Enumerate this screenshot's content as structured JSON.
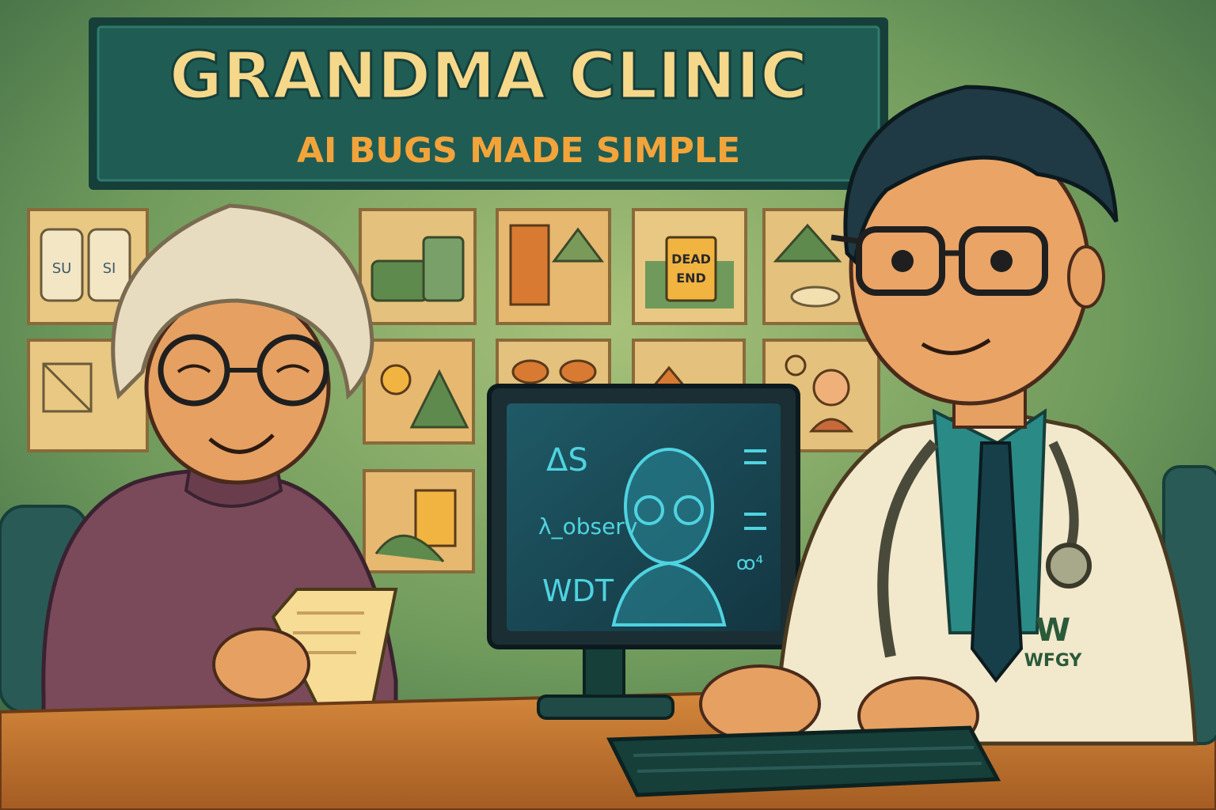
{
  "sign": {
    "title": "GRANDMA CLINIC",
    "subtitle": "AI BUGS MADE SIMPLE"
  },
  "posters": {
    "jar_label_1": "SU",
    "jar_label_2": "SI",
    "dead_end_line1": "DEAD",
    "dead_end_line2": "END"
  },
  "monitor": {
    "line1": "ΔS",
    "line2": "λ_observ",
    "line3": "WDT",
    "glyph": "ꝏ⁴"
  },
  "doctor": {
    "coat_logo": "W",
    "coat_text": "WFGY"
  },
  "colors": {
    "wall": "#6f9a5c",
    "sign_bg": "#1f5c54",
    "sign_text": "#f6d88a",
    "sign_sub": "#f2a43a",
    "desk": "#c97a34",
    "screen": "#1b4a55",
    "hologram": "#4fd3e0"
  }
}
